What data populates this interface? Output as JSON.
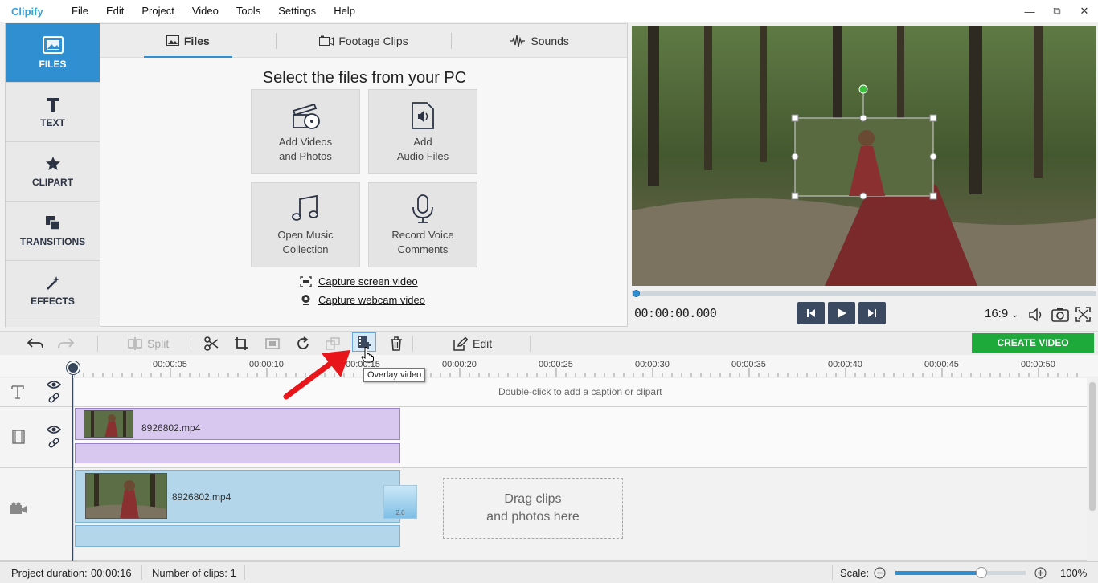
{
  "app": {
    "logo": "Clipify",
    "menu": [
      "File",
      "Edit",
      "Project",
      "Video",
      "Tools",
      "Settings",
      "Help"
    ]
  },
  "sidebar": {
    "items": [
      {
        "label": "FILES",
        "icon": "image-icon",
        "active": true
      },
      {
        "label": "TEXT",
        "icon": "text-icon",
        "active": false
      },
      {
        "label": "CLIPART",
        "icon": "star-icon",
        "active": false
      },
      {
        "label": "TRANSITIONS",
        "icon": "transitions-icon",
        "active": false
      },
      {
        "label": "EFFECTS",
        "icon": "magic-wand-icon",
        "active": false
      }
    ]
  },
  "files_panel": {
    "tabs": [
      {
        "label": "Files",
        "icon": "image-icon",
        "active": true
      },
      {
        "label": "Footage Clips",
        "icon": "camera-icon",
        "active": false
      },
      {
        "label": "Sounds",
        "icon": "waveform-icon",
        "active": false
      }
    ],
    "title": "Select the files from your PC",
    "tiles": [
      {
        "line1": "Add Videos",
        "line2": "and Photos",
        "icon": "film-clapper-icon"
      },
      {
        "line1": "Add",
        "line2": "Audio Files",
        "icon": "audio-file-icon"
      },
      {
        "line1": "Open Music",
        "line2": "Collection",
        "icon": "music-notes-icon"
      },
      {
        "line1": "Record Voice",
        "line2": "Comments",
        "icon": "microphone-icon"
      }
    ],
    "capture_screen": "Capture screen video",
    "capture_webcam": "Capture webcam video"
  },
  "preview": {
    "timecode": "00:00:00.000",
    "aspect_ratio": "16:9",
    "seek_progress": 0
  },
  "toolbar": {
    "split_label": "Split",
    "edit_label": "Edit",
    "create_label": "CREATE VIDEO",
    "tooltip": "Overlay video"
  },
  "timeline": {
    "ticks": [
      "00:00:05",
      "00:00:10",
      "00:00:15",
      "00:00:20",
      "00:00:25",
      "00:00:30",
      "00:00:35",
      "00:00:40",
      "00:00:45",
      "00:00:50"
    ],
    "caption_hint": "Double-click to add a caption or clipart",
    "overlay_clip_name": "8926802.mp4",
    "main_clip_name": "8926802.mp4",
    "transition_duration": "2.0",
    "dropzone_line1": "Drag clips",
    "dropzone_line2": "and photos here"
  },
  "status": {
    "duration_label": "Project duration:",
    "duration_value": "00:00:16",
    "clips_label": "Number of clips: 1",
    "scale_label": "Scale:",
    "scale_value": "100%",
    "scale_slider_fraction": 0.66
  },
  "colors": {
    "accent": "#2f8fd0",
    "create_button": "#1daa3b",
    "overlay_clip": "#d8c8f0",
    "main_clip": "#b3d6ea",
    "arrow": "#e8151b"
  }
}
